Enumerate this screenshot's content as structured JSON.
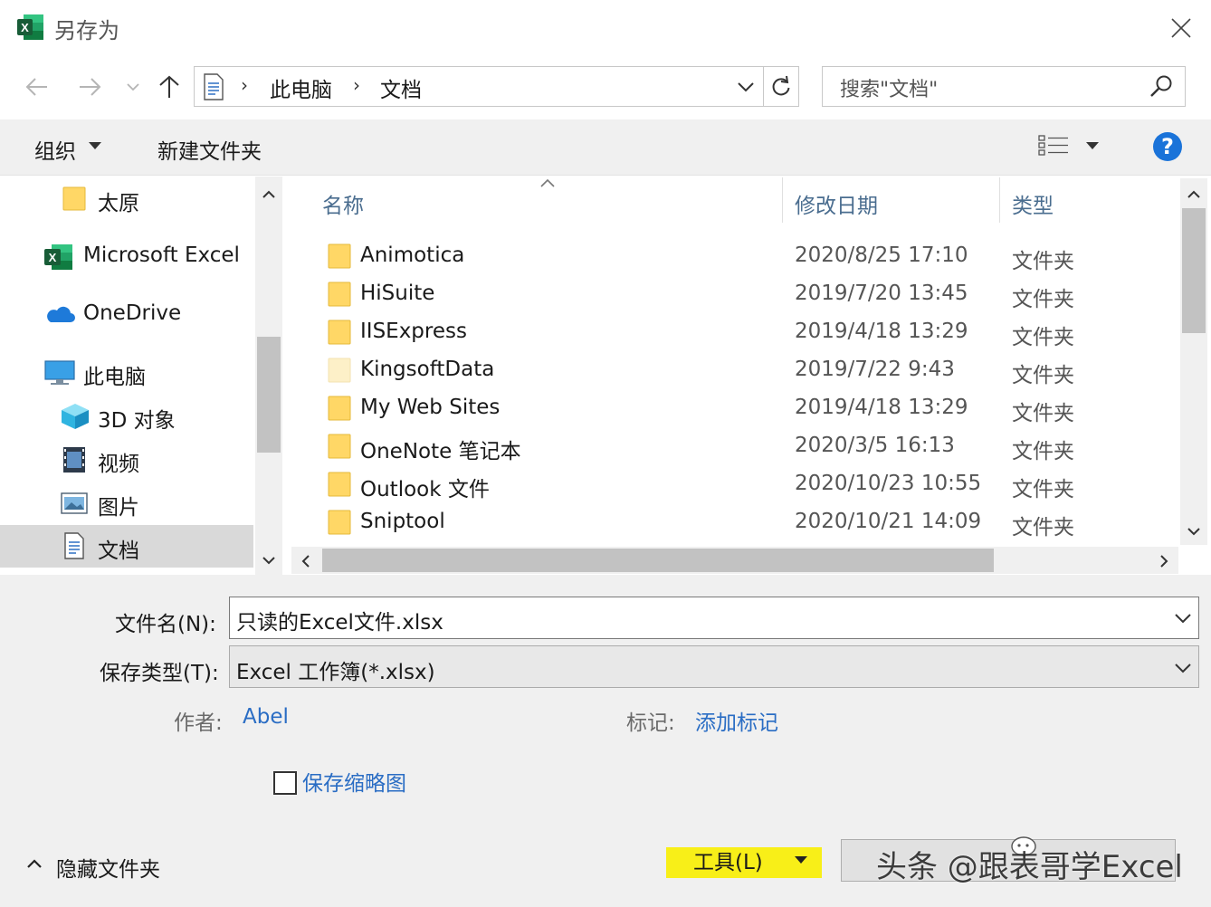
{
  "window": {
    "title": "另存为"
  },
  "address": {
    "crumbs": [
      "此电脑",
      "文档"
    ],
    "search_placeholder": "搜索\"文档\""
  },
  "toolbar": {
    "organize_label": "组织",
    "new_folder_label": "新建文件夹",
    "help_glyph": "?"
  },
  "sidebar": {
    "items": [
      {
        "label": "太原",
        "icon": "folder-icon"
      },
      {
        "label": "Microsoft Excel",
        "icon": "excel-icon"
      },
      {
        "label": "OneDrive",
        "icon": "onedrive-cloud-icon"
      },
      {
        "label": "此电脑",
        "icon": "computer-icon"
      },
      {
        "label": "3D 对象",
        "icon": "3d-objects-icon"
      },
      {
        "label": "视频",
        "icon": "video-icon"
      },
      {
        "label": "图片",
        "icon": "pictures-icon"
      },
      {
        "label": "文档",
        "icon": "documents-icon",
        "selected": true
      }
    ]
  },
  "file_list": {
    "columns": [
      "名称",
      "修改日期",
      "类型"
    ],
    "rows": [
      {
        "name": "Animotica",
        "date": "2020/8/25 17:10",
        "type": "文件夹"
      },
      {
        "name": "HiSuite",
        "date": "2019/7/20 13:45",
        "type": "文件夹"
      },
      {
        "name": "IISExpress",
        "date": "2019/4/18 13:29",
        "type": "文件夹"
      },
      {
        "name": "KingsoftData",
        "date": "2019/7/22 9:43",
        "type": "文件夹"
      },
      {
        "name": "My Web Sites",
        "date": "2019/4/18 13:29",
        "type": "文件夹"
      },
      {
        "name": "OneNote 笔记本",
        "date": "2020/3/5 16:13",
        "type": "文件夹"
      },
      {
        "name": "Outlook 文件",
        "date": "2020/10/23 10:55",
        "type": "文件夹"
      },
      {
        "name": "Sniptool",
        "date": "2020/10/21 14:09",
        "type": "文件夹"
      }
    ]
  },
  "form": {
    "filename_label": "文件名(N):",
    "filename_value": "只读的Excel文件.xlsx",
    "filetype_label": "保存类型(T):",
    "filetype_value": "Excel 工作簿(*.xlsx)",
    "author_label": "作者:",
    "author_value": "Abel",
    "tags_label": "标记:",
    "tags_value": "添加标记",
    "thumbnail_label": "保存缩略图"
  },
  "footer": {
    "hide_folders_label": "隐藏文件夹",
    "tools_label": "工具(L)",
    "watermark_text": "头条 @跟表哥学Excel"
  },
  "colors": {
    "accent": "#2a6dc4",
    "highlight": "#f8ef18",
    "excel_green": "#1d7a43",
    "help_blue": "#1a73d9"
  }
}
